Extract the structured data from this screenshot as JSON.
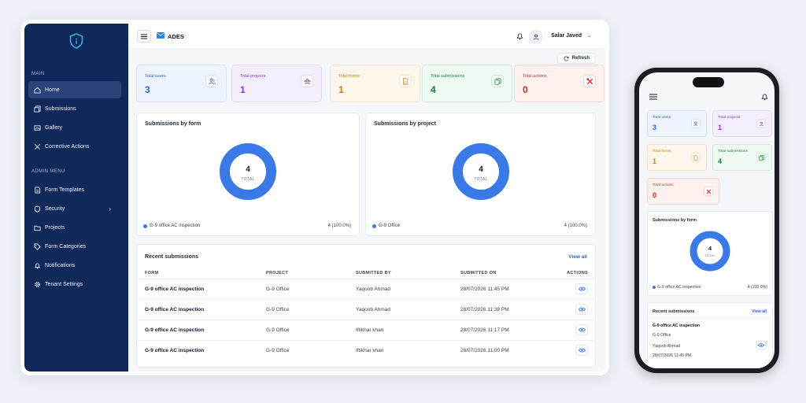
{
  "sidebar": {
    "sections": {
      "main": "MAIN",
      "admin": "ADMIN MENU"
    },
    "items": [
      {
        "label": "Home",
        "icon": "home-icon",
        "active": true
      },
      {
        "label": "Submissions",
        "icon": "copy-icon"
      },
      {
        "label": "Gallery",
        "icon": "image-icon"
      },
      {
        "label": "Corrective Actions",
        "icon": "tools-icon"
      },
      {
        "label": "Form Templates",
        "icon": "document-icon"
      },
      {
        "label": "Security",
        "icon": "shield-icon"
      },
      {
        "label": "Projects",
        "icon": "folder-icon"
      },
      {
        "label": "Form Categories",
        "icon": "tag-icon"
      },
      {
        "label": "Notifications",
        "icon": "bell-icon"
      },
      {
        "label": "Tenant Settings",
        "icon": "gear-icon"
      }
    ]
  },
  "header": {
    "brand": "ADES",
    "user_name": "Salar Javed"
  },
  "refresh_label": "Refresh",
  "stats": [
    {
      "label": "Total users",
      "value": "3",
      "color": "#2563eb",
      "bg": "#eef4ff",
      "border": "#d5e3fb",
      "icon": "users-icon"
    },
    {
      "label": "Total projects",
      "value": "1",
      "color": "#7c3aed",
      "bg": "#f4efff",
      "border": "#e3d8fb",
      "icon": "team-icon"
    },
    {
      "label": "Total forms",
      "value": "1",
      "color": "#d97706",
      "bg": "#fff7ec",
      "border": "#f8e2c3",
      "icon": "document-icon"
    },
    {
      "label": "Total submissions",
      "value": "4",
      "color": "#15803d",
      "bg": "#effaf2",
      "border": "#d0ecd9",
      "icon": "copy-icon"
    },
    {
      "label": "Total actions",
      "value": "0",
      "color": "#dc2626",
      "bg": "#fff1ee",
      "border": "#f8d6cf",
      "icon": "tools-icon"
    }
  ],
  "charts": {
    "by_form": {
      "title": "Submissions by form",
      "total": "4",
      "total_label": "TOTAL",
      "legend": "G-9 office AC inspection",
      "legend_value": "4 (100.0%)"
    },
    "by_project": {
      "title": "Submissions by project",
      "total": "4",
      "total_label": "TOTAL",
      "legend": "G-9 Office",
      "legend_value": "4 (100.0%)"
    }
  },
  "chart_data": [
    {
      "type": "pie",
      "title": "Submissions by form",
      "categories": [
        "G-9 office AC inspection"
      ],
      "values": [
        4
      ]
    },
    {
      "type": "pie",
      "title": "Submissions by project",
      "categories": [
        "G-9 Office"
      ],
      "values": [
        4
      ]
    }
  ],
  "recent": {
    "title": "Recent submissions",
    "view_all": "View all",
    "columns": [
      "FORM",
      "PROJECT",
      "SUBMITTED BY",
      "SUBMITTED ON",
      "ACTIONS"
    ],
    "rows": [
      {
        "form": "G-9 office AC inspection",
        "project": "G-9 Office",
        "by": "Yaqoob Ahmad",
        "on": "28/07/2026 11:45 PM"
      },
      {
        "form": "G-9 office AC inspection",
        "project": "G-9 Office",
        "by": "Yaqoob Ahmad",
        "on": "28/07/2026 11:38 PM"
      },
      {
        "form": "G-9 office AC inspection",
        "project": "G-9 Office",
        "by": "Iftikhar khan",
        "on": "28/07/2026 11:17 PM"
      },
      {
        "form": "G-9 office AC inspection",
        "project": "G-9 Office",
        "by": "Iftikhar khan",
        "on": "28/07/2026 11:00 PM"
      }
    ]
  },
  "mobile": {
    "chart": {
      "title": "Submissions by form",
      "total": "4",
      "total_label": "TOTAL",
      "legend": "G-9 office AC inspection",
      "legend_value": "4 (100.0%)"
    },
    "recent": {
      "title": "Recent submissions",
      "view_all": "View all",
      "form": "G-9 office AC inspection",
      "project": "G-9 Office",
      "by": "Yaqoob Ahmad",
      "on": "28/07/2026 11:45 PM"
    }
  }
}
